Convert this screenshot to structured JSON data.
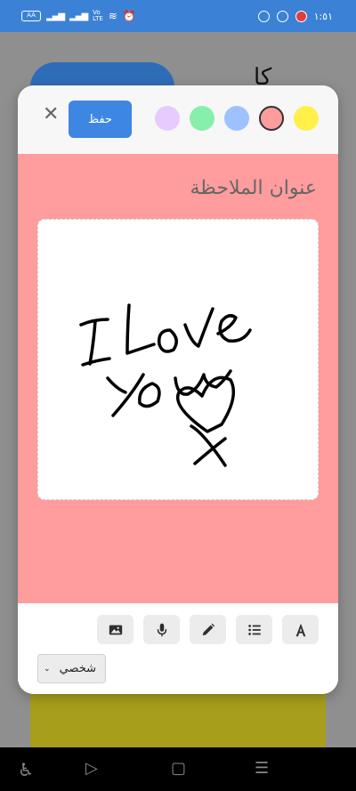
{
  "status_bar": {
    "battery": "AA",
    "time": "١:٥١"
  },
  "modal": {
    "save_label": "حفظ",
    "colors": [
      {
        "hex": "#e7cbff",
        "selected": false
      },
      {
        "hex": "#86efac",
        "selected": false
      },
      {
        "hex": "#9ec2ff",
        "selected": false
      },
      {
        "hex": "#ff9c9d",
        "selected": true
      },
      {
        "hex": "#fff04a",
        "selected": false
      }
    ],
    "note_title": "عنوان الملاحظة",
    "note_color": "#ff9c9d",
    "toolbar": [
      "text-format-icon",
      "list-icon",
      "pencil-icon",
      "microphone-icon",
      "image-icon"
    ],
    "category": "شخصي"
  },
  "background": {
    "char": "كا"
  }
}
